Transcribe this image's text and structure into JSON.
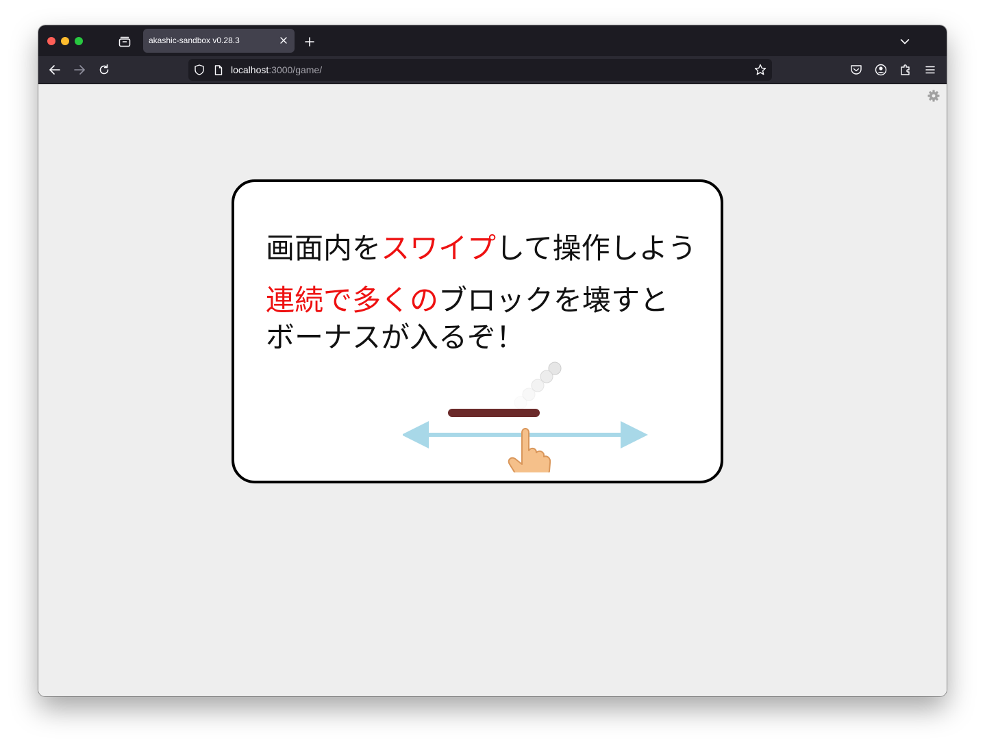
{
  "browser": {
    "tab": {
      "title": "akashic-sandbox v0.28.3"
    },
    "url": {
      "host": "localhost",
      "path": ":3000/game/"
    }
  },
  "game": {
    "line1": {
      "part1": "画面内を",
      "part2": "スワイプ",
      "part3": "して操作しよう"
    },
    "line2": {
      "part1": "連続で多くの",
      "part2": "ブロックを壊すと"
    },
    "line3": "ボーナスが入るぞ！"
  },
  "colors": {
    "highlight": "#ee1111",
    "paddle": "#6b2a2a",
    "arrow": "#a8d8e8",
    "hand": "#f5c08a"
  },
  "icons": {
    "settings": "gear-icon",
    "back": "back-arrow-icon",
    "forward": "forward-arrow-icon",
    "reload": "reload-icon",
    "bookmark": "star-icon",
    "pocket": "pocket-icon",
    "account": "account-icon",
    "extensions": "puzzle-icon",
    "menu": "hamburger-menu-icon"
  }
}
